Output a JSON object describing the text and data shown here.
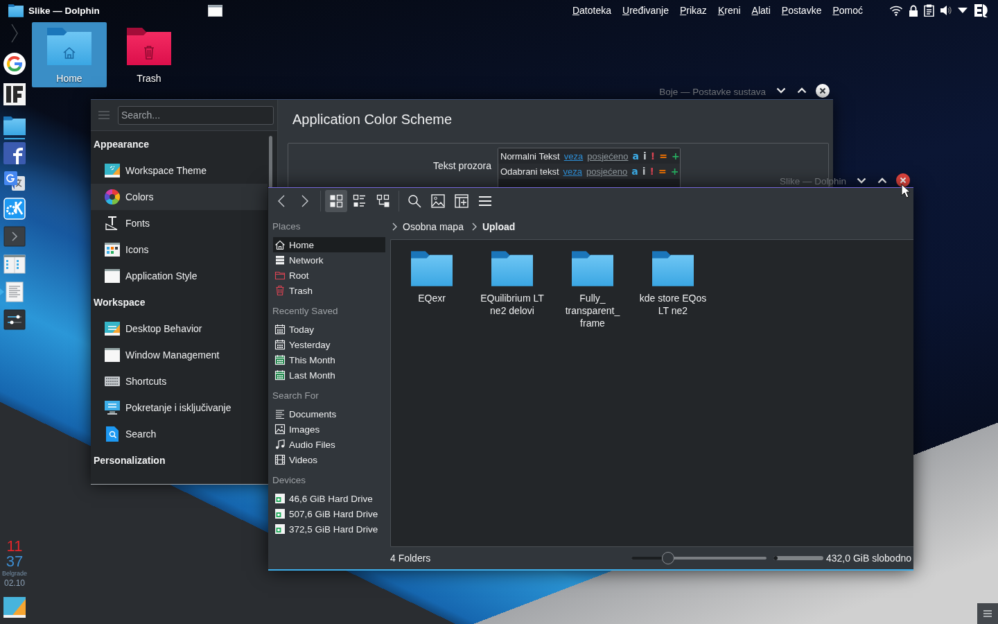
{
  "top_panel": {
    "window_title": "Slike — Dolphin",
    "menu": [
      "Datoteka",
      "Uređivanje",
      "Prikaz",
      "Kreni",
      "Alati",
      "Postavke",
      "Pomoć"
    ]
  },
  "dock": {
    "launchers": [
      {
        "running": false,
        "attention": false
      },
      {
        "running": false,
        "attention": false
      },
      {
        "running": true,
        "attention": false
      },
      {
        "running": false,
        "attention": false
      },
      {
        "running": false,
        "attention": false
      },
      {
        "running": false,
        "attention": false
      },
      {
        "running": false,
        "attention": false
      },
      {
        "running": false,
        "attention": false
      },
      {
        "running": false,
        "attention": true
      },
      {
        "running": false,
        "attention": false
      }
    ],
    "clock": {
      "hour": "11",
      "minute": "37",
      "city": "Belgrade",
      "date": "02.10"
    }
  },
  "desktop_icons": [
    {
      "label": "Home",
      "kind": "home",
      "selected": true
    },
    {
      "label": "Trash",
      "kind": "trash",
      "selected": false
    }
  ],
  "settings_window": {
    "title": "Boje — Postavke sustava",
    "active": false,
    "search": {
      "placeholder": "Search..."
    },
    "sidebar": [
      {
        "title": "Appearance",
        "items": [
          {
            "label": "Workspace Theme",
            "kind": "theme",
            "selected": false
          },
          {
            "label": "Colors",
            "kind": "colors",
            "selected": true
          },
          {
            "label": "Fonts",
            "kind": "fonts",
            "selected": false
          },
          {
            "label": "Icons",
            "kind": "icons",
            "selected": false
          },
          {
            "label": "Application Style",
            "kind": "style",
            "selected": false
          }
        ]
      },
      {
        "title": "Workspace",
        "items": [
          {
            "label": "Desktop Behavior",
            "kind": "behavior",
            "selected": false
          },
          {
            "label": "Window Management",
            "kind": "windows",
            "selected": false
          },
          {
            "label": "Shortcuts",
            "kind": "shortcuts",
            "selected": false
          },
          {
            "label": "Pokretanje i isključivanje",
            "kind": "startup",
            "selected": false
          },
          {
            "label": "Search",
            "kind": "search",
            "selected": false
          }
        ]
      },
      {
        "title": "Personalization"
      }
    ],
    "page_title": "Application Color Scheme",
    "preview": {
      "label": "Tekst prozora",
      "rows": [
        {
          "tokens": [
            {
              "text": "Normalni Tekst",
              "kind": "plain",
              "color": "#eff0f1"
            },
            {
              "text": "veza",
              "kind": "link",
              "color": "#2e8fd6"
            },
            {
              "text": "posjećeno",
              "kind": "link",
              "color": "#8e979c"
            },
            {
              "text": "a",
              "kind": "symbol",
              "color": "#3daee9"
            },
            {
              "text": "i",
              "kind": "symbol",
              "color": "#bdc3c7"
            },
            {
              "text": "!",
              "kind": "symbol",
              "color": "#da4453"
            },
            {
              "text": "=",
              "kind": "symbol",
              "color": "#f67400"
            },
            {
              "text": "+",
              "kind": "symbol",
              "color": "#27ae60"
            }
          ]
        },
        {
          "tokens": [
            {
              "text": "Odabrani tekst",
              "kind": "plain",
              "color": "#eff0f1"
            },
            {
              "text": "veza",
              "kind": "link",
              "color": "#2e8fd6"
            },
            {
              "text": "posjećeno",
              "kind": "link",
              "color": "#8e979c"
            },
            {
              "text": "a",
              "kind": "symbol",
              "color": "#3daee9"
            },
            {
              "text": "i",
              "kind": "symbol",
              "color": "#bdc3c7"
            },
            {
              "text": "!",
              "kind": "symbol",
              "color": "#da4453"
            },
            {
              "text": "=",
              "kind": "symbol",
              "color": "#f67400"
            },
            {
              "text": "+",
              "kind": "symbol",
              "color": "#27ae60"
            }
          ]
        }
      ]
    }
  },
  "dolphin_window": {
    "title": "Slike — Dolphin",
    "active": true,
    "view_modes": [
      {
        "kind": "icons",
        "selected": true
      },
      {
        "kind": "compact",
        "selected": false
      },
      {
        "kind": "details",
        "selected": false
      }
    ],
    "places": [
      {
        "title": "Places",
        "items": [
          {
            "label": "Home",
            "kind": "home",
            "selected": true
          },
          {
            "label": "Network",
            "kind": "network",
            "selected": false
          },
          {
            "label": "Root",
            "kind": "root",
            "selected": false
          },
          {
            "label": "Trash",
            "kind": "trash",
            "selected": false
          }
        ]
      },
      {
        "title": "Recently Saved",
        "items": [
          {
            "label": "Today",
            "kind": "day",
            "selected": false
          },
          {
            "label": "Yesterday",
            "kind": "day",
            "selected": false
          },
          {
            "label": "This Month",
            "kind": "month",
            "selected": false
          },
          {
            "label": "Last Month",
            "kind": "month",
            "selected": false
          }
        ]
      },
      {
        "title": "Search For",
        "items": [
          {
            "label": "Documents",
            "kind": "documents",
            "selected": false
          },
          {
            "label": "Images",
            "kind": "images",
            "selected": false
          },
          {
            "label": "Audio Files",
            "kind": "audio",
            "selected": false
          },
          {
            "label": "Videos",
            "kind": "videos",
            "selected": false
          }
        ]
      },
      {
        "title": "Devices",
        "items": [
          {
            "label": "46,6 GiB Hard Drive",
            "kind": "drive",
            "selected": false
          },
          {
            "label": "507,6 GiB Hard Drive",
            "kind": "drive",
            "selected": false
          },
          {
            "label": "372,5 GiB Hard Drive",
            "kind": "drive",
            "selected": false
          }
        ]
      }
    ],
    "breadcrumb": [
      {
        "label": "Osobna mapa",
        "current": false
      },
      {
        "label": "Upload",
        "current": true
      }
    ],
    "files": [
      {
        "name": "EQexr"
      },
      {
        "name": "EQuilibrium LT ne2 delovi"
      },
      {
        "name": "Fully_ transparent_ frame"
      },
      {
        "name": "kde store EQos LT ne2"
      }
    ],
    "status_bar": {
      "summary": "4 Folders",
      "zoom": {
        "level": 0.27
      },
      "free_space": {
        "level": 0.08,
        "text": "432,0 GiB slobodno"
      }
    }
  }
}
